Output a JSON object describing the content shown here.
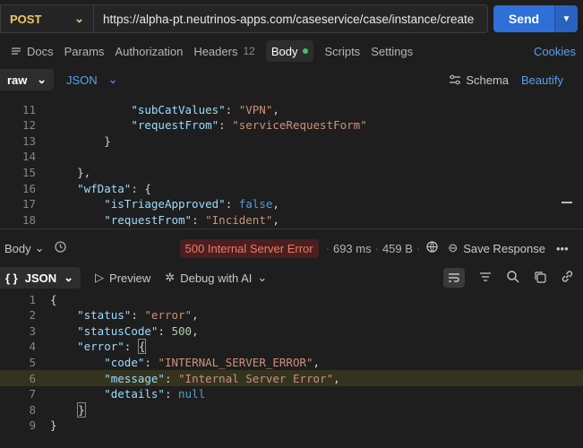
{
  "request": {
    "method": "POST",
    "url": "https://alpha-pt.neutrinos-apps.com/caseservice/case/instance/create",
    "send_label": "Send"
  },
  "req_tabs": {
    "docs": "Docs",
    "params": "Params",
    "authorization": "Authorization",
    "headers": "Headers",
    "headers_count": "12",
    "body": "Body",
    "scripts": "Scripts",
    "settings": "Settings",
    "cookies": "Cookies"
  },
  "body_opts": {
    "mode": "raw",
    "format": "JSON",
    "schema": "Schema",
    "beautify": "Beautify"
  },
  "request_lines": [
    {
      "n": "11",
      "indent": "            ",
      "parts": [
        [
          "k",
          "\"subCatValues\""
        ],
        [
          "p",
          ": "
        ],
        [
          "s",
          "\"VPN\""
        ],
        [
          "p",
          ","
        ]
      ]
    },
    {
      "n": "12",
      "indent": "            ",
      "parts": [
        [
          "k",
          "\"requestFrom\""
        ],
        [
          "p",
          ": "
        ],
        [
          "s",
          "\"serviceRequestForm\""
        ]
      ]
    },
    {
      "n": "13",
      "indent": "        ",
      "parts": [
        [
          "p",
          "}"
        ]
      ]
    },
    {
      "n": "14",
      "indent": "",
      "parts": []
    },
    {
      "n": "15",
      "indent": "    ",
      "parts": [
        [
          "p",
          "},"
        ]
      ]
    },
    {
      "n": "16",
      "indent": "    ",
      "parts": [
        [
          "k",
          "\"wfData\""
        ],
        [
          "p",
          ": {"
        ]
      ]
    },
    {
      "n": "17",
      "indent": "        ",
      "parts": [
        [
          "k",
          "\"isTriageApproved\""
        ],
        [
          "p",
          ": "
        ],
        [
          "b",
          "false"
        ],
        [
          "p",
          ","
        ]
      ]
    },
    {
      "n": "18",
      "indent": "        ",
      "parts": [
        [
          "k",
          "\"requestFrom\""
        ],
        [
          "p",
          ": "
        ],
        [
          "s",
          "\"Incident\""
        ],
        [
          "p",
          ","
        ]
      ]
    }
  ],
  "response": {
    "body_label": "Body",
    "status": "500 Internal Server Error",
    "time": "693 ms",
    "size": "459 B",
    "save": "Save Response",
    "format": "JSON",
    "preview": "Preview",
    "debug": "Debug with AI"
  },
  "response_lines": [
    {
      "n": "1",
      "indent": "",
      "parts": [
        [
          "p",
          "{"
        ]
      ]
    },
    {
      "n": "2",
      "indent": "    ",
      "parts": [
        [
          "k",
          "\"status\""
        ],
        [
          "p",
          ": "
        ],
        [
          "s",
          "\"error\""
        ],
        [
          "p",
          ","
        ]
      ]
    },
    {
      "n": "3",
      "indent": "    ",
      "parts": [
        [
          "k",
          "\"statusCode\""
        ],
        [
          "p",
          ": "
        ],
        [
          "n",
          "500"
        ],
        [
          "p",
          ","
        ]
      ]
    },
    {
      "n": "4",
      "indent": "    ",
      "parts": [
        [
          "k",
          "\"error\""
        ],
        [
          "p",
          ": "
        ],
        [
          "c",
          "{"
        ]
      ]
    },
    {
      "n": "5",
      "indent": "        ",
      "parts": [
        [
          "k",
          "\"code\""
        ],
        [
          "p",
          ": "
        ],
        [
          "s",
          "\"INTERNAL_SERVER_ERROR\""
        ],
        [
          "p",
          ","
        ]
      ]
    },
    {
      "n": "6",
      "indent": "        ",
      "parts": [
        [
          "k",
          "\"message\""
        ],
        [
          "p",
          ": "
        ],
        [
          "s",
          "\"Internal Server Error\""
        ],
        [
          "p",
          ","
        ]
      ],
      "highlight": true
    },
    {
      "n": "7",
      "indent": "        ",
      "parts": [
        [
          "k",
          "\"details\""
        ],
        [
          "p",
          ": "
        ],
        [
          "b",
          "null"
        ]
      ]
    },
    {
      "n": "8",
      "indent": "    ",
      "parts": [
        [
          "c",
          "}"
        ]
      ]
    },
    {
      "n": "9",
      "indent": "",
      "parts": [
        [
          "p",
          "}"
        ]
      ]
    }
  ],
  "colors": {
    "method": "#f1c86b",
    "accent": "#2f6fd8",
    "link": "#5aa0f0",
    "error": "#f07a6a"
  }
}
